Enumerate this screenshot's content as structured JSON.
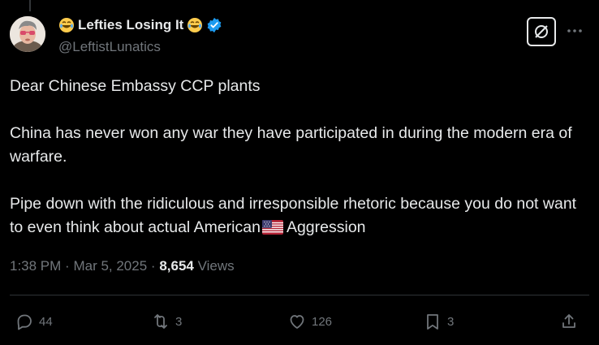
{
  "author": {
    "name": "Lefties Losing It",
    "handle": "@LeftistLunatics",
    "verified": true,
    "name_emoji": "joy-emoji"
  },
  "post": {
    "paragraphs": [
      "Dear Chinese Embassy CCP plants",
      "China has never won any war they have participated in during the modern era of warfare.",
      "Pipe down with the ridiculous and irresponsible rhetoric because you do not want to even think about actual American"
    ],
    "last_paragraph_suffix": "Aggression",
    "inline_emoji": "us-flag-emoji"
  },
  "meta": {
    "time": "1:38 PM",
    "separator": "·",
    "date": "Mar 5, 2025",
    "views_count": "8,654",
    "views_label": "Views"
  },
  "actions": {
    "replies": "44",
    "reposts": "3",
    "likes": "126",
    "bookmarks": "3"
  },
  "colors": {
    "background": "#000000",
    "text": "#e7e9ea",
    "muted": "#71767b",
    "verified": "#1d9bf0",
    "divider": "#2f3336"
  }
}
